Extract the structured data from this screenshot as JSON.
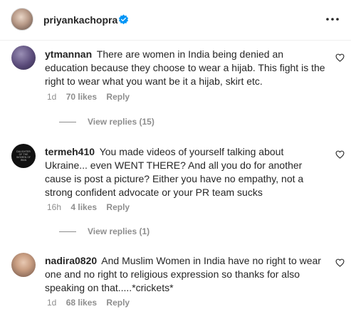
{
  "header": {
    "username": "priyankachopra",
    "verified_icon": "verified-badge-icon",
    "more_icon": "more-options-icon"
  },
  "comments": [
    {
      "username": "ytmannan",
      "text": "There are women in India being denied an education because they choose to wear a hijab. This fight is the right to wear what you want be it a hijab, skirt etc.",
      "time": "1d",
      "likes": "70 likes",
      "reply_label": "Reply",
      "view_replies": "View replies (15)"
    },
    {
      "username": "termeh410",
      "avatar_text": "DAUGHTER OF THE WOMEN OF IRAN",
      "text": "You made videos of yourself talking about Ukraine... even WENT THERE? And all you do for another cause is post a picture? Either you have no empathy, not a strong confident advocate or your PR team sucks",
      "time": "16h",
      "likes": "4 likes",
      "reply_label": "Reply",
      "view_replies": "View replies (1)"
    },
    {
      "username": "nadira0820",
      "text": "And Muslim Women in India have no right to wear one and no right to religious expression so thanks for also speaking on that.....*crickets*",
      "time": "1d",
      "likes": "68 likes",
      "reply_label": "Reply"
    }
  ],
  "colors": {
    "text": "#262626",
    "secondary": "#8e8e8e",
    "verified": "#0095f6"
  }
}
